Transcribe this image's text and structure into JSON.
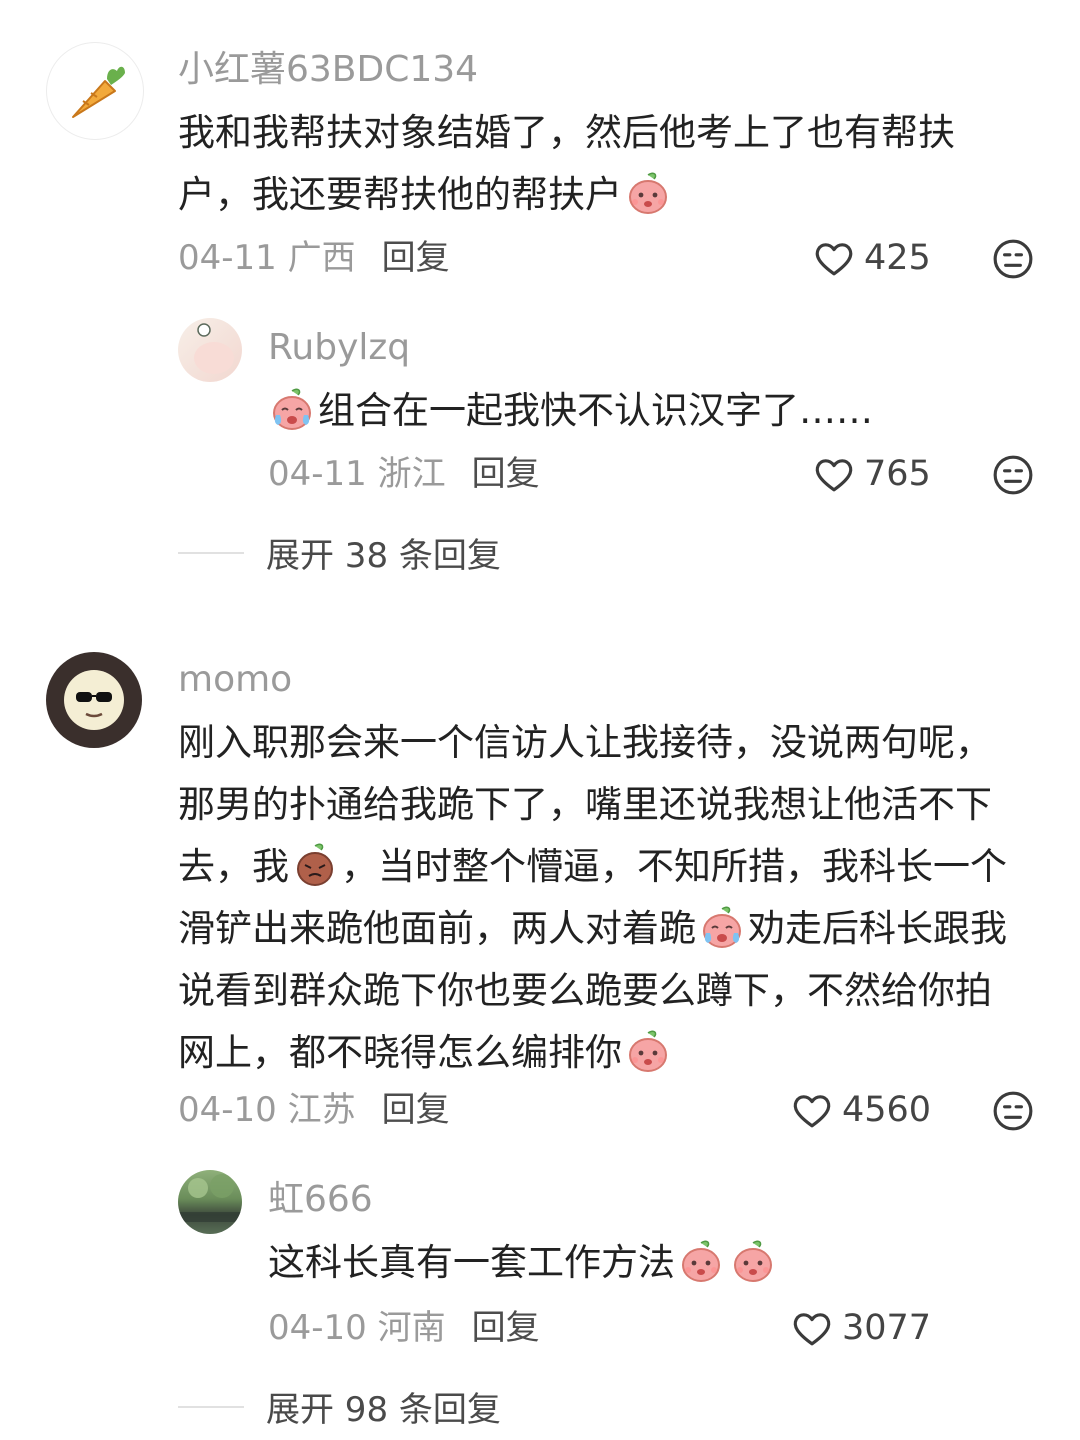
{
  "comments": [
    {
      "username": "小红薯63BDC134",
      "lines": [
        "我和我帮扶对象结婚了，然后他考上了也有帮扶",
        "户，我还要帮扶他的帮扶户"
      ],
      "date": "04-11 广西",
      "reply_label": "回复",
      "likes": "425",
      "replies": [
        {
          "username": "Rubylzq",
          "text": "组合在一起我快不认识汉字了……",
          "date": "04-11 浙江",
          "reply_label": "回复",
          "likes": "765"
        }
      ],
      "expand_label": "展开 38 条回复"
    },
    {
      "username": "momo",
      "lines": [
        "刚入职那会来一个信访人让我接待，没说两句呢，",
        "那男的扑通给我跪下了，嘴里还说我想让他活不下",
        "去，我",
        "，当时整个懵逼，不知所措，我科长一个",
        "滑铲出来跪他面前，两人对着跪",
        "劝走后科长跟我",
        "说看到群众跪下你也要么跪要么蹲下，不然给你拍",
        "网上，都不晓得怎么编排你"
      ],
      "date": "04-10 江苏",
      "reply_label": "回复",
      "likes": "4560",
      "replies": [
        {
          "username": "虹666",
          "text": "这科长真有一套工作方法",
          "date": "04-10 河南",
          "reply_label": "回复",
          "likes": "3077"
        }
      ],
      "expand_label": "展开 98 条回复"
    }
  ],
  "icons": {
    "like": "heart-outline-icon",
    "dislike": "neutral-face-icon",
    "emoji": "peach-sticker-icon"
  },
  "colors": {
    "muted_text": "#9a9a9a",
    "body_text": "#222222",
    "divider": "#e1e1e1",
    "sticker_pink": "#f6a5a5"
  }
}
